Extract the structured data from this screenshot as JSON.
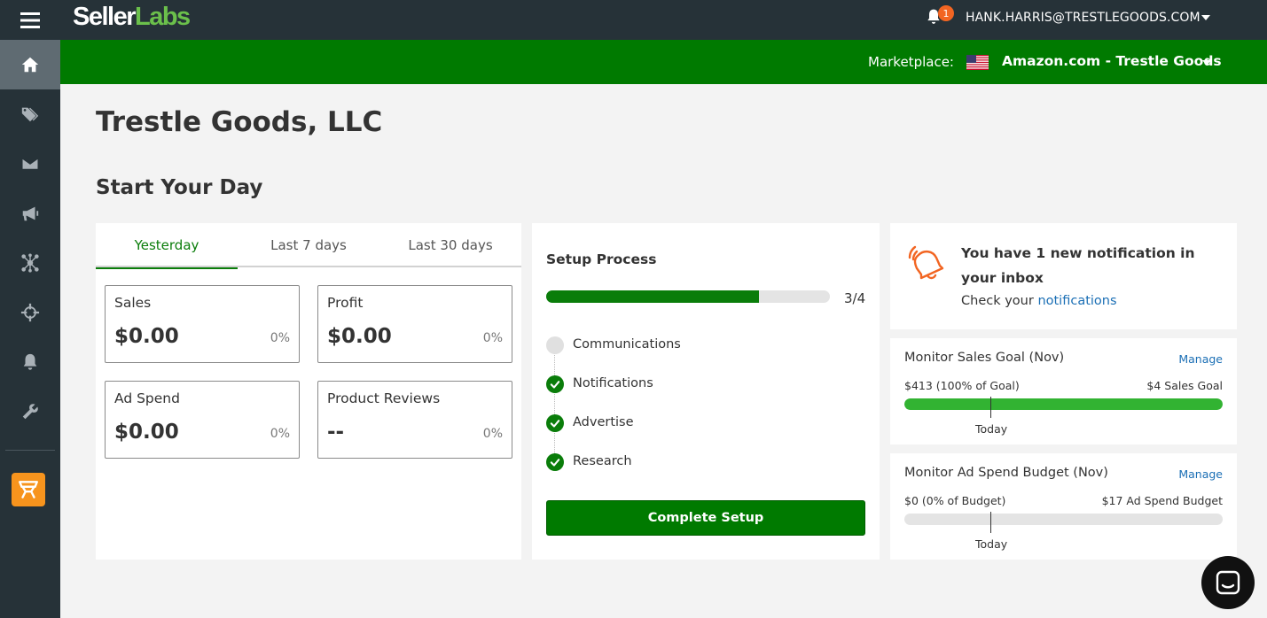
{
  "brand": {
    "logo_a": "Seller",
    "logo_b": "Labs"
  },
  "header": {
    "notification_count": "1",
    "user_email": "HANK.HARRIS@TRESTLEGOODS.COM"
  },
  "marketplace": {
    "label": "Marketplace:",
    "value": "Amazon.com - Trestle Goods"
  },
  "sidebar": {
    "items": [
      {
        "icon": "home-icon",
        "active": true
      },
      {
        "icon": "tag-icon"
      },
      {
        "icon": "mail-icon"
      },
      {
        "icon": "megaphone-icon"
      },
      {
        "icon": "network-icon"
      },
      {
        "icon": "crosshair-icon"
      },
      {
        "icon": "bell-icon"
      },
      {
        "icon": "wrench-icon"
      }
    ],
    "app_icon": "storefront-icon"
  },
  "page": {
    "company": "Trestle Goods, LLC",
    "section_title": "Start Your Day"
  },
  "stats": {
    "tabs": [
      "Yesterday",
      "Last 7 days",
      "Last 30 days"
    ],
    "active_tab": "Yesterday",
    "cards": [
      {
        "label": "Sales",
        "value": "$0.00",
        "pct": "0%"
      },
      {
        "label": "Profit",
        "value": "$0.00",
        "pct": "0%"
      },
      {
        "label": "Ad Spend",
        "value": "$0.00",
        "pct": "0%"
      },
      {
        "label": "Product Reviews",
        "value": "--",
        "pct": "0%"
      }
    ]
  },
  "setup": {
    "title": "Setup Process",
    "progress_fraction": 0.75,
    "progress_text": "3/4",
    "steps": [
      {
        "label": "Communications",
        "done": false
      },
      {
        "label": "Notifications",
        "done": true
      },
      {
        "label": "Advertise",
        "done": true
      },
      {
        "label": "Research",
        "done": true
      }
    ],
    "button": "Complete Setup"
  },
  "notification": {
    "title": "You have 1 new notification in your inbox",
    "text_prefix": "Check your ",
    "link": "notifications"
  },
  "monitors": [
    {
      "title": "Monitor Sales Goal (Nov)",
      "manage": "Manage",
      "left": "$413 (100% of Goal)",
      "right": "$4 Sales Goal",
      "fill_fraction": 1.0,
      "today": "Today"
    },
    {
      "title": "Monitor Ad Spend Budget (Nov)",
      "manage": "Manage",
      "left": "$0 (0% of Budget)",
      "right": "$17 Ad Spend Budget",
      "fill_fraction": 0.0,
      "today": "Today"
    }
  ],
  "colors": {
    "brand_green": "#007a00",
    "sidebar": "#263238",
    "accent_orange": "#f26522",
    "link_blue": "#1b6fb5"
  }
}
